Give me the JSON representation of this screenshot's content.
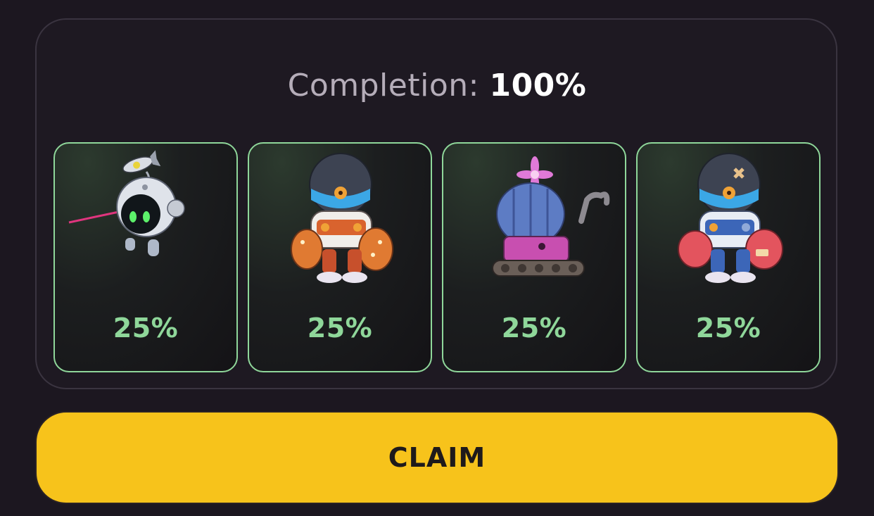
{
  "completion": {
    "label": "Completion:",
    "value": "100%"
  },
  "cards": [
    {
      "name": "drone bot",
      "percent": "25%",
      "icon": "satellite-robot-icon"
    },
    {
      "name": "orange mech",
      "percent": "25%",
      "icon": "orange-mech-robot-icon"
    },
    {
      "name": "cactus tank",
      "percent": "25%",
      "icon": "cactus-tank-robot-icon"
    },
    {
      "name": "blue mech",
      "percent": "25%",
      "icon": "blue-mech-robot-icon"
    }
  ],
  "claim_button": {
    "label": "CLAIM"
  },
  "colors": {
    "background": "#1c1720",
    "card_border": "#8fd79a",
    "percent_text": "#8fd79a",
    "claim_button": "#f7c31b"
  }
}
